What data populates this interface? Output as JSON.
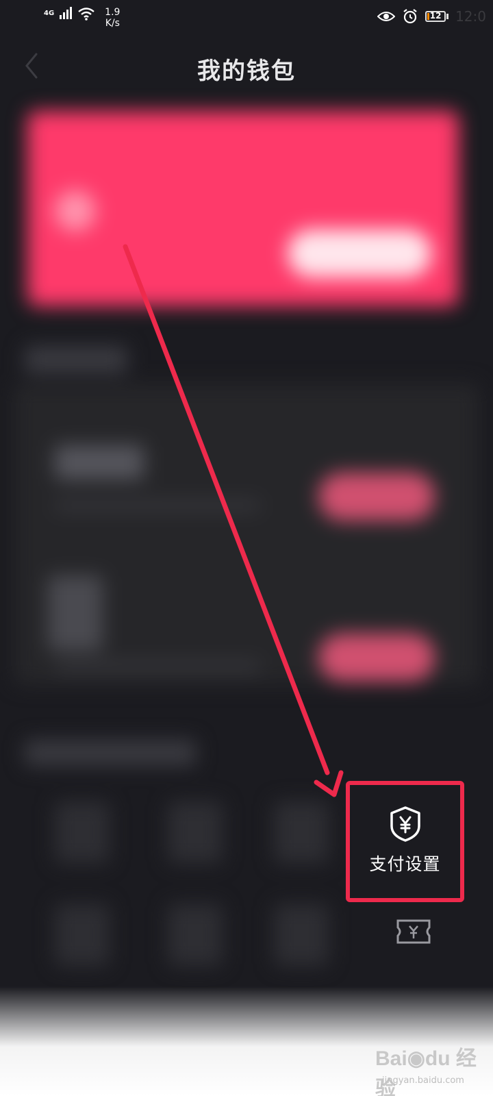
{
  "status_bar": {
    "network": "4G",
    "speed_value": "1.9",
    "speed_unit": "K/s",
    "battery": "12",
    "battery_level_percent": 12,
    "time": "12:0"
  },
  "header": {
    "title": "我的钱包"
  },
  "quick_actions": {
    "pay_settings_label": "支付设置"
  },
  "colors": {
    "accent": "#fe2c55",
    "highlight": "#ee2a4c",
    "background": "#1b1b20"
  },
  "icons": {
    "back": "chevron-left-icon",
    "pay_settings": "shield-yen-icon",
    "coupon": "ticket-yen-icon",
    "annotation": "red-arrow"
  },
  "watermark": {
    "brand": "Bai",
    "brand_suffix": "经验",
    "url": "jingyan.baidu.com"
  }
}
